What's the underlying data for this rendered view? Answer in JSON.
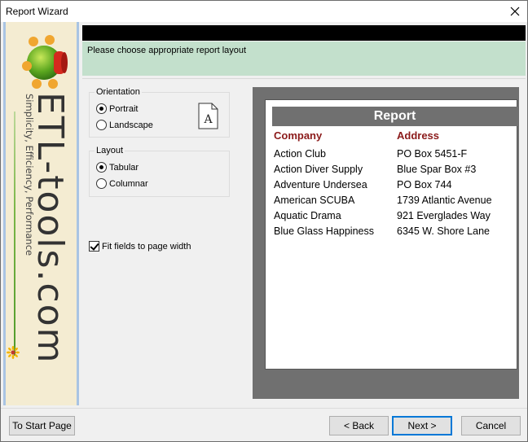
{
  "window": {
    "title": "Report Wizard",
    "close_glyph": "✕"
  },
  "sidebar": {
    "brand": "ETL-tools.com",
    "tagline": "Simplicity, Efficiency, Performance",
    "logo_icon": "molecule-logo-icon",
    "flower_icon": "sunflower-icon"
  },
  "banner": {
    "instruction": "Please choose appropriate report layout"
  },
  "orientation": {
    "label": "Orientation",
    "options": [
      "Portrait",
      "Landscape"
    ],
    "selected": "Portrait",
    "page_icon_letter": "A"
  },
  "layout": {
    "label": "Layout",
    "options": [
      "Tabular",
      "Columnar"
    ],
    "selected": "Tabular"
  },
  "fit_fields": {
    "label": "Fit fields to page width",
    "checked": true
  },
  "preview": {
    "title": "Report",
    "columns": [
      "Company",
      "Address"
    ],
    "rows": [
      [
        "Action Club",
        "PO Box 5451-F"
      ],
      [
        "Action Diver Supply",
        "Blue Spar Box #3"
      ],
      [
        "Adventure Undersea",
        "PO Box 744"
      ],
      [
        "American SCUBA",
        "1739 Atlantic Avenue"
      ],
      [
        "Aquatic Drama",
        "921 Everglades Way"
      ],
      [
        "Blue Glass Happiness",
        "6345 W. Shore Lane"
      ]
    ]
  },
  "buttons": {
    "start_page": "To Start Page",
    "back": "< Back",
    "next": "Next >",
    "cancel": "Cancel"
  },
  "colors": {
    "banner_dark": "#000000",
    "banner_green": "#c3e0cc",
    "sidebar_bg": "#f4ecd2",
    "sidebar_border": "#a9c4e3",
    "preview_bg": "#707070",
    "column_header": "#8b1a1a"
  }
}
